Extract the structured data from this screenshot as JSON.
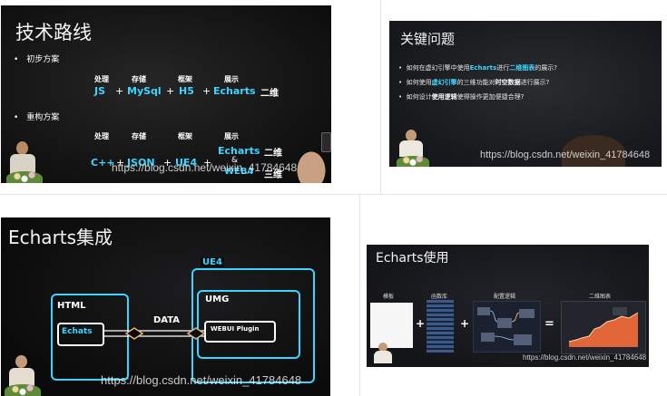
{
  "slides": {
    "s1": {
      "title": "技术路线",
      "section1": "初步方案",
      "section2": "重构方案",
      "row1_headers": [
        "处理",
        "存储",
        "框架",
        "展示"
      ],
      "row1_values": [
        "JS",
        "MySql",
        "H5",
        "Echarts"
      ],
      "row1_extra": "二维",
      "row2_headers": [
        "处理",
        "存储",
        "框架",
        "展示"
      ],
      "row2_values": [
        "C++",
        "JSON",
        "UE4",
        "Echarts"
      ],
      "row2_amp": "&",
      "row2_under": "WEB4",
      "row2_extra1": "二维",
      "row2_extra2": "三维",
      "plus": "+",
      "watermark": "https://blog.csdn.net/weixin_41784648"
    },
    "s2": {
      "title": "关键问题",
      "q1a": "如何在虚幻引擎中使用",
      "q1b": "Echarts",
      "q1c": "进行",
      "q1d": "二维图表",
      "q1e": "的展示?",
      "q2a": "如何使用",
      "q2b": "虚幻引擎",
      "q2c": "的三维功能对",
      "q2d": "时空数据",
      "q2e": "进行展示?",
      "q3a": "如何设计",
      "q3b": "使用逻辑",
      "q3c": "使得操作更加便捷合理?",
      "watermark": "https://blog.csdn.net/weixin_41784648"
    },
    "s3": {
      "title": "Echarts集成",
      "ue4": "UE4",
      "html": "HTML",
      "umg": "UMG",
      "echats": "Echats",
      "data": "DATA",
      "webui": "WEBUI Plugin",
      "watermark": "https://blog.csdn.net/weixin_41784648"
    },
    "s4": {
      "title": "Echarts使用",
      "labels": [
        "模板",
        "函数库",
        "配置逻辑",
        "二维图表"
      ],
      "plus": "+",
      "equals": "=",
      "watermark": "https://blog.csdn.net/weixin_41784648"
    }
  },
  "colors": {
    "cyan": "#3fd3ff",
    "slide_bg": "#101010",
    "grid_line": "#e3e3e3"
  }
}
